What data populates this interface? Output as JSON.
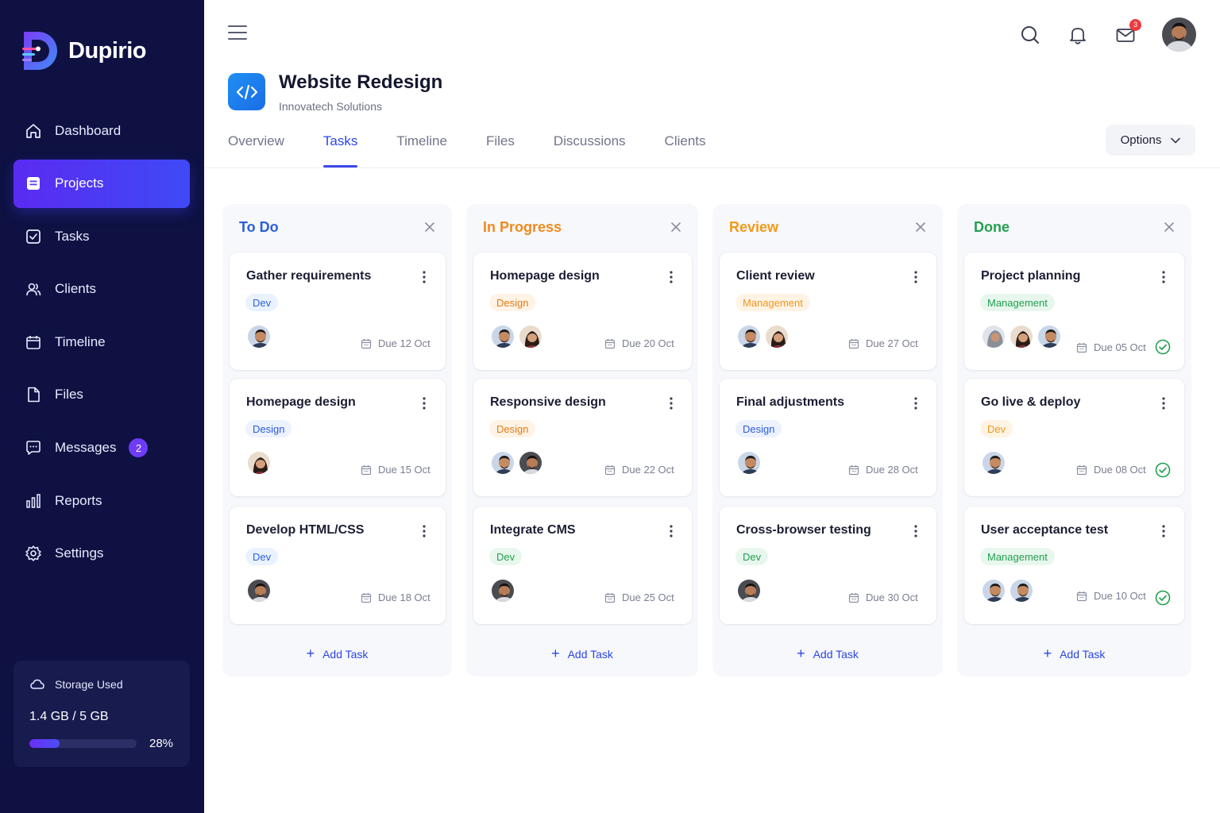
{
  "app": {
    "name": "Dupirio"
  },
  "sidebar": {
    "items": [
      {
        "label": "Dashboard"
      },
      {
        "label": "Projects"
      },
      {
        "label": "Tasks"
      },
      {
        "label": "Clients"
      },
      {
        "label": "Timeline"
      },
      {
        "label": "Files"
      },
      {
        "label": "Messages",
        "badge": "2"
      },
      {
        "label": "Reports"
      },
      {
        "label": "Settings"
      }
    ],
    "storage": {
      "title": "Storage Used",
      "amount": "1.4 GB / 5 GB",
      "percent_label": "28%",
      "percent": 28
    }
  },
  "topbar": {
    "mail_badge": "3"
  },
  "project": {
    "title": "Website Redesign",
    "subtitle": "Innovatech Solutions"
  },
  "tabs": [
    "Overview",
    "Tasks",
    "Timeline",
    "Files",
    "Discussions",
    "Clients"
  ],
  "options_label": "Options",
  "columns": [
    {
      "title": "To Do",
      "color": "#2b5fd9",
      "cards": [
        {
          "title": "Gather requirements",
          "tag": "Dev",
          "due": "Due 12 Oct"
        },
        {
          "title": "Homepage design",
          "tag": "Design",
          "due": "Due 15 Oct"
        },
        {
          "title": "Develop HTML/CSS",
          "tag": "Dev",
          "due": "Due 18 Oct"
        }
      ],
      "add_label": "Add Task"
    },
    {
      "title": "In Progress",
      "color": "#ef8a1c",
      "cards": [
        {
          "title": "Homepage design",
          "tag": "Design",
          "due": "Due 20 Oct"
        },
        {
          "title": "Responsive design",
          "tag": "Design",
          "due": "Due 22 Oct"
        },
        {
          "title": "Integrate CMS",
          "tag": "Dev",
          "due": "Due 25 Oct"
        }
      ],
      "add_label": "Add Task"
    },
    {
      "title": "Review",
      "color": "#f29a1a",
      "cards": [
        {
          "title": "Client review",
          "tag": "Management",
          "due": "Due 27 Oct"
        },
        {
          "title": "Final adjustments",
          "tag": "Design",
          "due": "Due 28 Oct"
        },
        {
          "title": "Cross-browser testing",
          "tag": "Dev",
          "due": "Due 30 Oct"
        }
      ],
      "add_label": "Add Task"
    },
    {
      "title": "Done",
      "color": "#23a04f",
      "cards": [
        {
          "title": "Project planning",
          "tag": "Management",
          "due": "Due 05 Oct"
        },
        {
          "title": "Go live & deploy",
          "tag": "Dev",
          "due": "Due 08 Oct"
        },
        {
          "title": "User acceptance test",
          "tag": "Management",
          "due": "Due 10 Oct"
        }
      ],
      "add_label": "Add Task"
    }
  ]
}
